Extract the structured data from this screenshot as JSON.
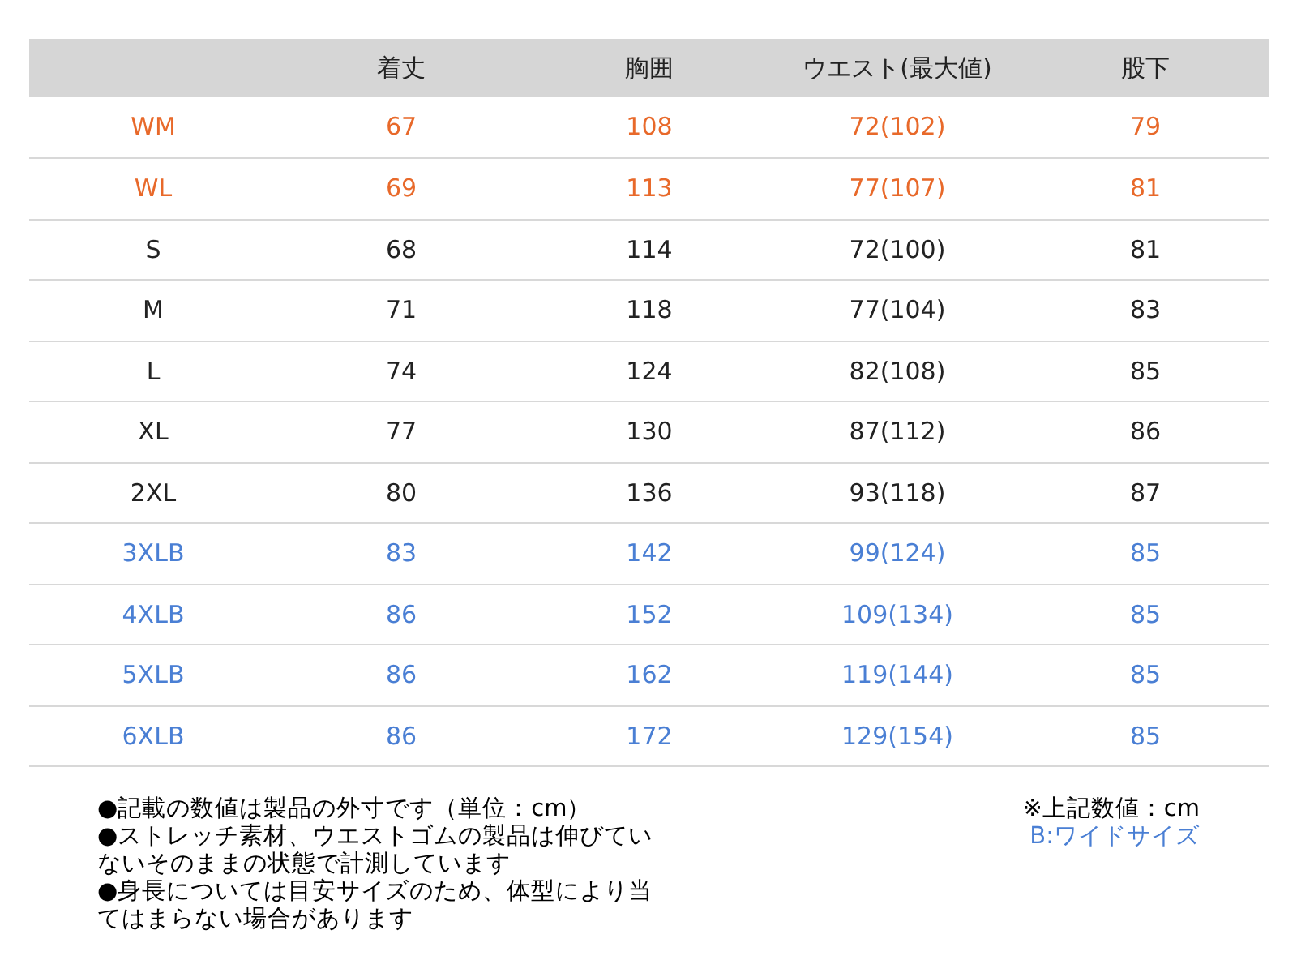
{
  "table": {
    "columns": [
      "",
      "着丈",
      "胸囲",
      "ウエスト(最大値)",
      "股下"
    ],
    "rows": [
      {
        "color": "#e8692a",
        "cells": [
          "WM",
          "67",
          "108",
          "72(102)",
          "79"
        ]
      },
      {
        "color": "#e8692a",
        "cells": [
          "WL",
          "69",
          "113",
          "77(107)",
          "81"
        ]
      },
      {
        "color": "#222222",
        "cells": [
          "S",
          "68",
          "114",
          "72(100)",
          "81"
        ]
      },
      {
        "color": "#222222",
        "cells": [
          "M",
          "71",
          "118",
          "77(104)",
          "83"
        ]
      },
      {
        "color": "#222222",
        "cells": [
          "L",
          "74",
          "124",
          "82(108)",
          "85"
        ]
      },
      {
        "color": "#222222",
        "cells": [
          "XL",
          "77",
          "130",
          "87(112)",
          "86"
        ]
      },
      {
        "color": "#222222",
        "cells": [
          "2XL",
          "80",
          "136",
          "93(118)",
          "87"
        ]
      },
      {
        "color": "#4a7fd4",
        "cells": [
          "3XLB",
          "83",
          "142",
          "99(124)",
          "85"
        ]
      },
      {
        "color": "#4a7fd4",
        "cells": [
          "4XLB",
          "86",
          "152",
          "109(134)",
          "85"
        ]
      },
      {
        "color": "#4a7fd4",
        "cells": [
          "5XLB",
          "86",
          "162",
          "119(144)",
          "85"
        ]
      },
      {
        "color": "#4a7fd4",
        "cells": [
          "6XLB",
          "86",
          "172",
          "129(154)",
          "85"
        ]
      }
    ]
  },
  "notes": [
    "●記載の数値は製品の外寸です（単位：cm）",
    "●ストレッチ素材、ウエストゴムの製品は伸びていないそのままの状態で計測しています",
    "●身長については目安サイズのため、体型により当てはまらない場合があります"
  ],
  "unit_note": "※上記数値：cm",
  "legend": {
    "text": "B:ワイドサイズ",
    "color": "#4a7fd4"
  }
}
